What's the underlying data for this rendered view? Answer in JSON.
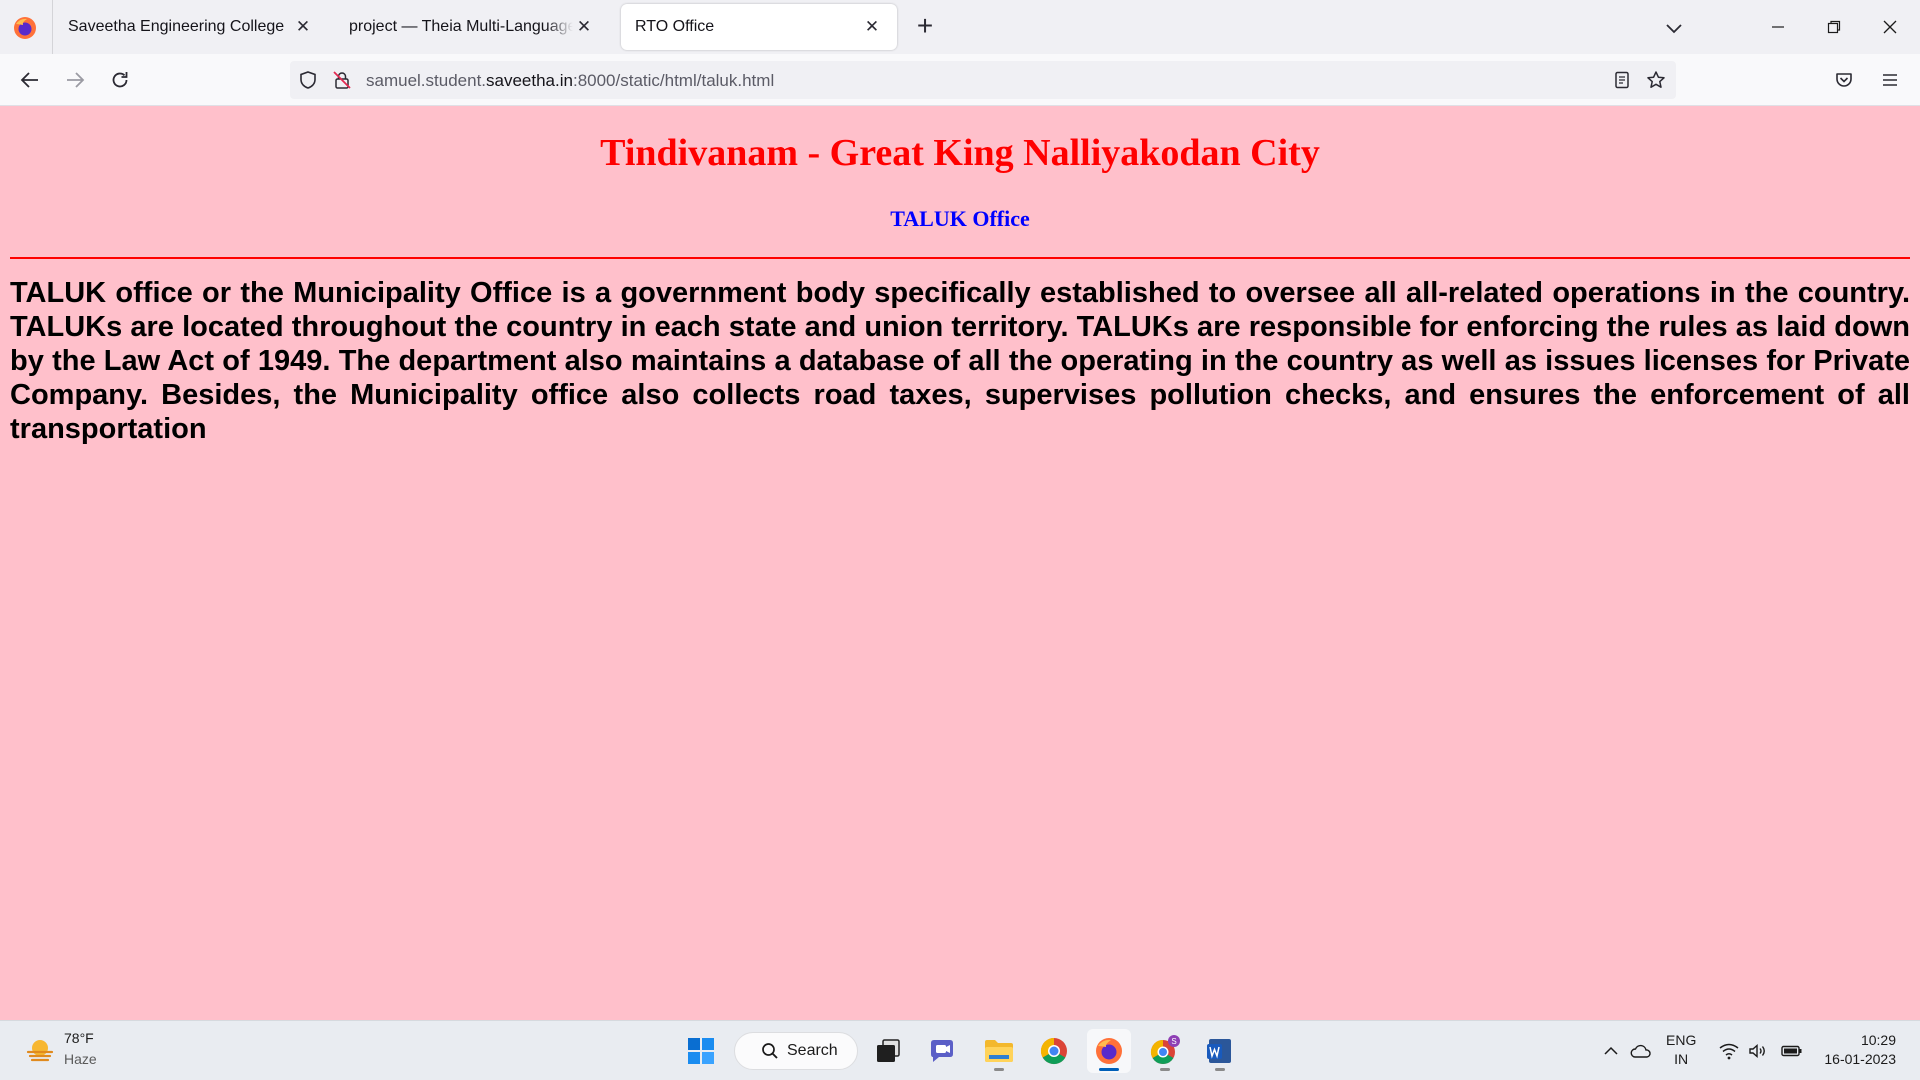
{
  "browser": {
    "tabs": [
      {
        "title": "Saveetha Engineering College",
        "active": false
      },
      {
        "title": "project — Theia Multi-Language Ex",
        "active": false
      },
      {
        "title": "RTO Office",
        "active": true
      }
    ],
    "url": {
      "prefix": "samuel.student.",
      "domain": "saveetha.in",
      "suffix": ":8000/static/html/taluk.html"
    }
  },
  "page": {
    "heading": "Tindivanam - Great King Nalliyakodan City",
    "subheading": "TALUK Office",
    "body": "TALUK office or the Municipality Office is a government body specifically established to oversee all all-related operations in the country. TALUKs are located throughout the country in each state and union territory. TALUKs are responsible for enforcing the rules as laid down by the Law Act of 1949. The department also maintains a database of all the operating in the country as well as issues licenses for Private Company. Besides, the Municipality office also collects road taxes, supervises pollution checks, and ensures the enforcement of all transportation",
    "colors": {
      "background": "#ffc0cb",
      "heading": "#ff0000",
      "subheading": "#0000ff",
      "rule": "#ff0000"
    }
  },
  "taskbar": {
    "weather": {
      "temp": "78°F",
      "condition": "Haze"
    },
    "search_label": "Search",
    "apps": [
      "windows-start-icon",
      "search",
      "task-view-icon",
      "teams-chat-icon",
      "file-explorer-icon",
      "chrome-icon",
      "firefox-icon",
      "chrome-profile-icon",
      "word-icon"
    ],
    "lang_line1": "ENG",
    "lang_line2": "IN",
    "time": "10:29",
    "date": "16-01-2023"
  }
}
